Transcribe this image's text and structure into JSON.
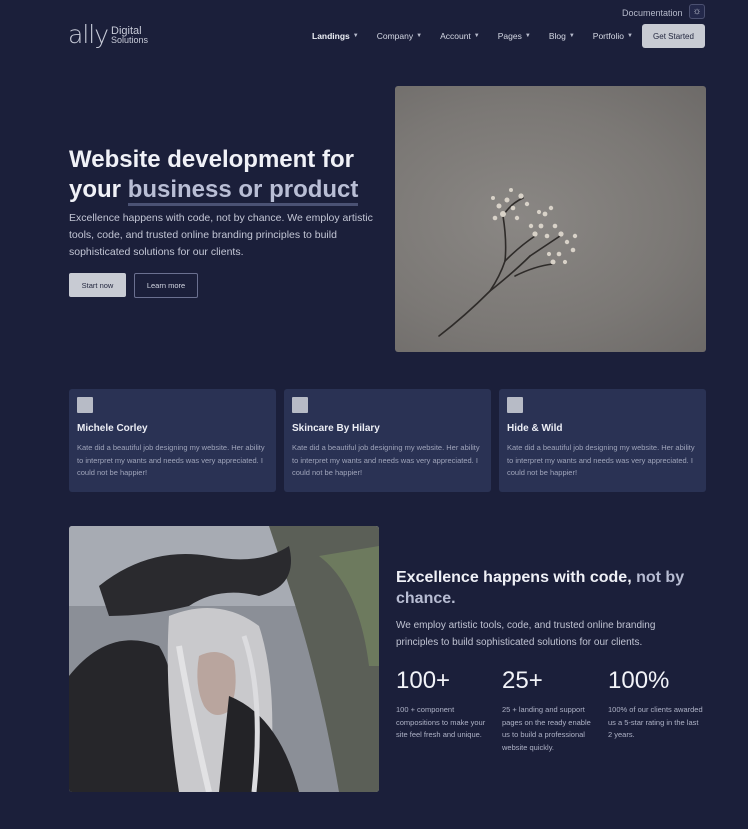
{
  "util": {
    "documentation_label": "Documentation",
    "theme_icon": "sun-icon"
  },
  "header": {
    "logo_mark": "ally",
    "logo_line1": "Digital",
    "logo_line2": "Solutions",
    "nav": [
      {
        "label": "Landings",
        "active": true
      },
      {
        "label": "Company"
      },
      {
        "label": "Account"
      },
      {
        "label": "Pages"
      },
      {
        "label": "Blog"
      },
      {
        "label": "Portfolio"
      }
    ],
    "cta_label": "Get Started"
  },
  "hero": {
    "title_start": "Website development for your",
    "title_accent": "business or product",
    "description": "Excellence happens with code, not by chance. We employ artistic tools, code, and trusted online branding principles to build sophisticated solutions for our clients.",
    "primary_label": "Start now",
    "secondary_label": "Learn more"
  },
  "testimonials": [
    {
      "name": "Michele Corley",
      "quote": "Kate did a beautiful job designing my website. Her ability to interpret my wants and needs was very appreciated. I could not be happier!"
    },
    {
      "name": "Skincare By Hilary",
      "quote": "Kate did a beautiful job designing my website. Her ability to interpret my wants and needs was very appreciated. I could not be happier!"
    },
    {
      "name": "Hide & Wild",
      "quote": "Kate did a beautiful job designing my website. Her ability to interpret my wants and needs was very appreciated. I could not be happier!"
    }
  ],
  "feature": {
    "title_start": "Excellence happens with code,",
    "title_muted": "not by chance.",
    "description": "We employ artistic tools, code, and trusted online branding principles to build sophisticated solutions for our clients.",
    "stats": [
      {
        "value": "100+",
        "label": "100 + component compositions to make your site feel fresh and unique."
      },
      {
        "value": "25+",
        "label": "25 + landing and support pages on the ready enable us to build a professional website quickly."
      },
      {
        "value": "100%",
        "label": "100% of our clients awarded us a 5-star rating in the last 2 years."
      }
    ]
  }
}
